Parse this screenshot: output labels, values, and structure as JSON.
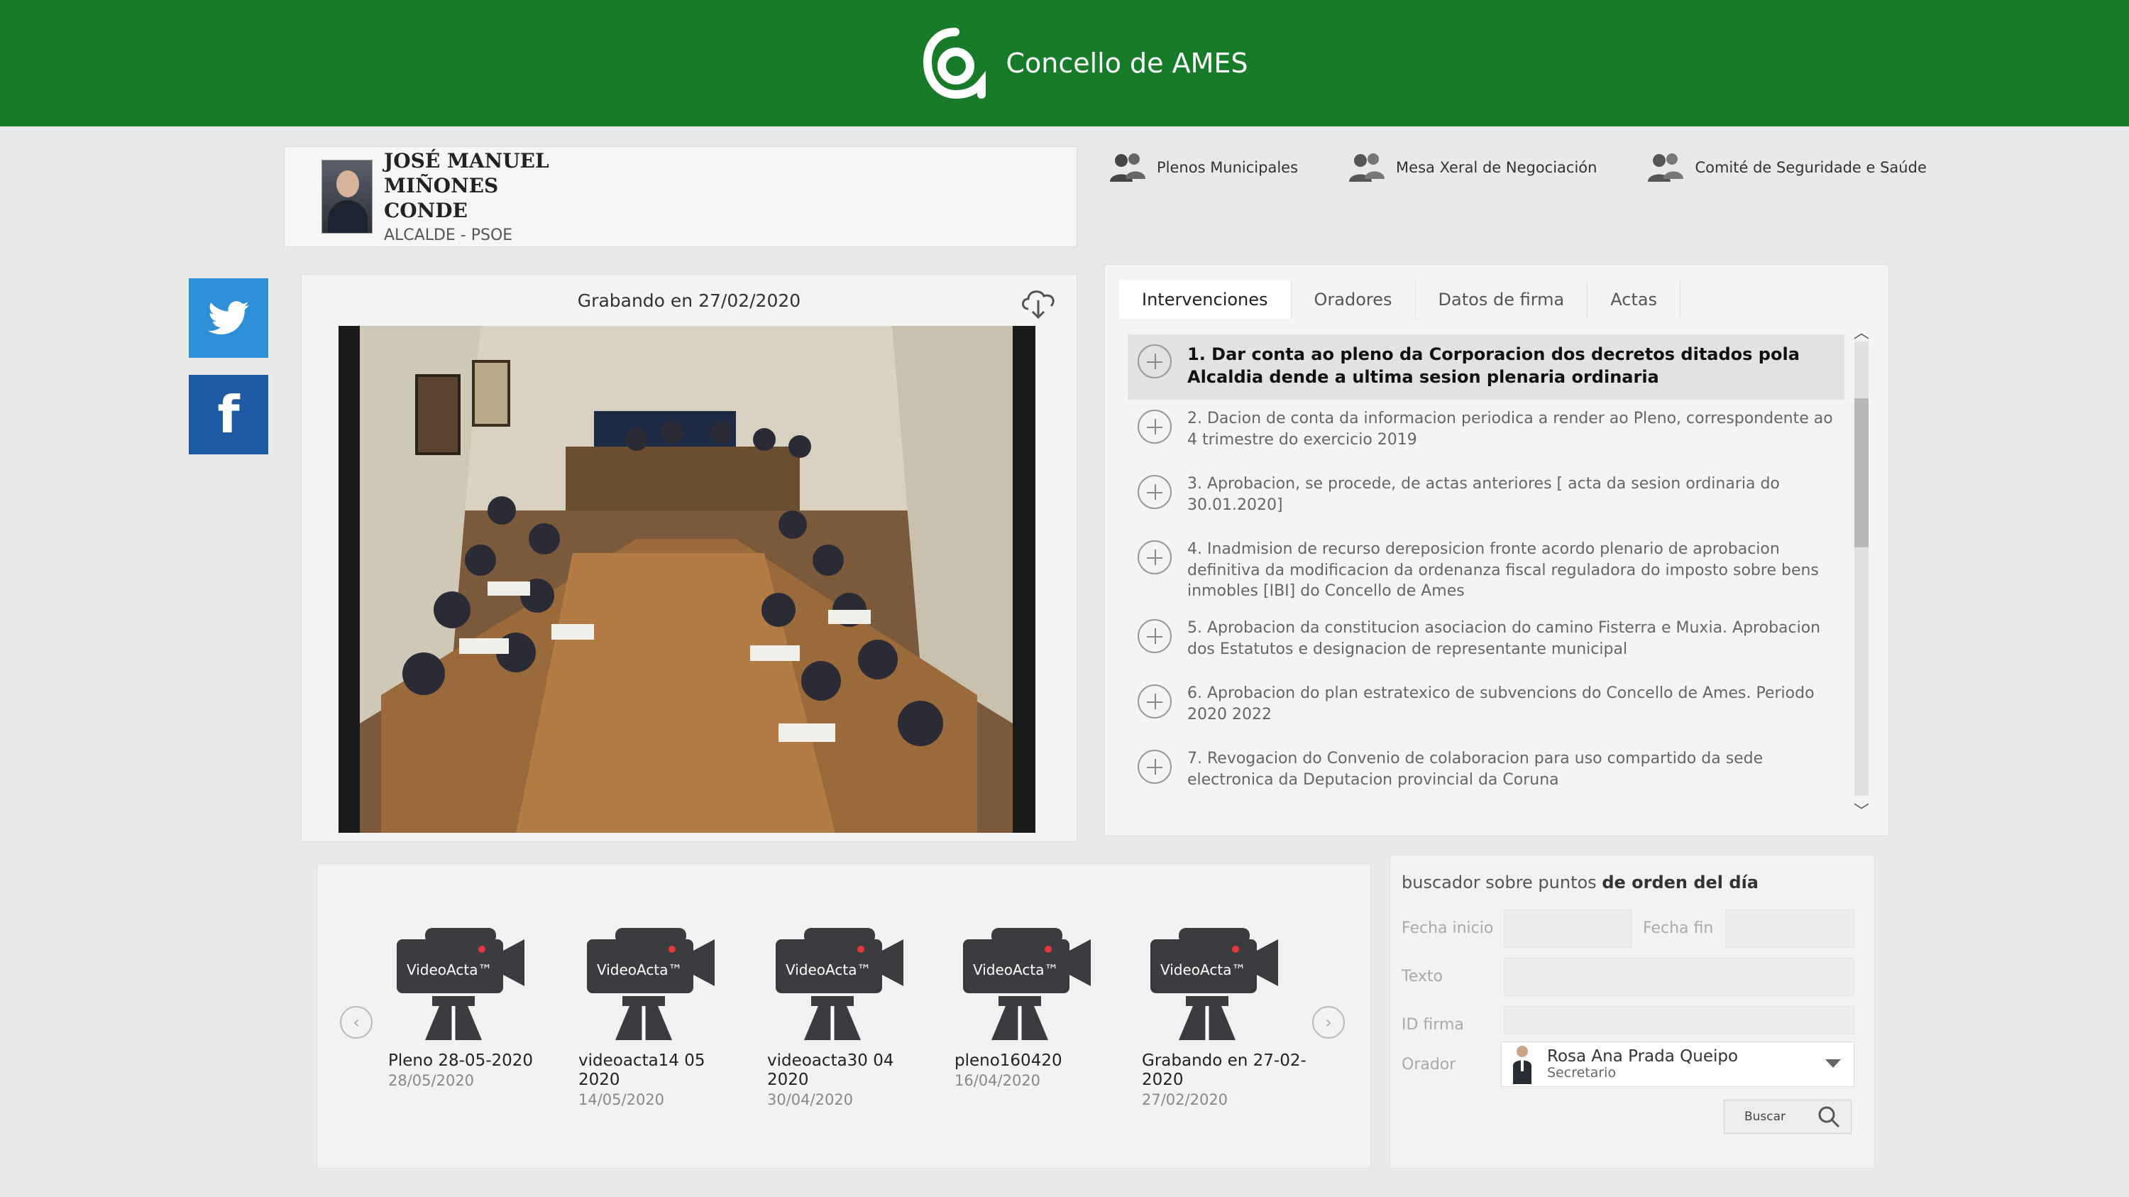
{
  "header": {
    "brand": "Concello de AMES"
  },
  "profile": {
    "name": "JOSÉ MANUEL MIÑONES CONDE",
    "role": "ALCALDE - PSOE"
  },
  "nav": [
    {
      "label": "Plenos Municipales"
    },
    {
      "label": "Mesa Xeral de Negociación"
    },
    {
      "label": "Comité de Seguridade e Saúde"
    }
  ],
  "video": {
    "recording_label": "Grabando en 27/02/2020"
  },
  "tabs": [
    "Intervenciones",
    "Oradores",
    "Datos de firma",
    "Actas"
  ],
  "agenda": [
    "1. Dar conta ao pleno da Corporacion dos decretos ditados pola Alcaldia dende a ultima sesion plenaria ordinaria",
    "2. Dacion de conta da informacion periodica a render ao Pleno, correspondente ao 4 trimestre do exercicio 2019",
    "3. Aprobacion, se procede, de actas anteriores [ acta da sesion ordinaria do 30.01.2020]",
    "4. Inadmision de recurso dereposicion fronte acordo plenario de aprobacion definitiva da modificacion da ordenanza fiscal reguladora do imposto sobre bens inmobles [IBI] do Concello de Ames",
    "5. Aprobacion da constitucion asociacion do camino Fisterra e Muxia. Aprobacion dos Estatutos e designacion de representante municipal",
    "6. Aprobacion do plan estratexico de subvencions do Concello de Ames. Periodo 2020 2022",
    "7. Revogacion do Convenio de colaboracion para uso compartido da sede electronica da Deputacion provincial da Coruna"
  ],
  "videos": [
    {
      "title": "Pleno 28-05-2020",
      "date": "28/05/2020"
    },
    {
      "title": "videoacta14 05 2020",
      "date": "14/05/2020"
    },
    {
      "title": "videoacta30 04 2020",
      "date": "30/04/2020"
    },
    {
      "title": "pleno160420",
      "date": "16/04/2020"
    },
    {
      "title": "Grabando en 27-02-2020",
      "date": "27/02/2020"
    }
  ],
  "camera_brand": "VideoActa™",
  "search": {
    "title_prefix": "buscador sobre puntos ",
    "title_bold": "de orden del día",
    "fecha_inicio_label": "Fecha inicio",
    "fecha_fin_label": "Fecha fin",
    "texto_label": "Texto",
    "id_firma_label": "ID firma",
    "orador_label": "Orador",
    "orador_name": "Rosa Ana Prada Queipo",
    "orador_role": "Secretario",
    "button_label": "Buscar"
  },
  "colors": {
    "header_green": "#177b2a",
    "twitter": "#2f8fd6",
    "facebook": "#1d5aa3"
  }
}
